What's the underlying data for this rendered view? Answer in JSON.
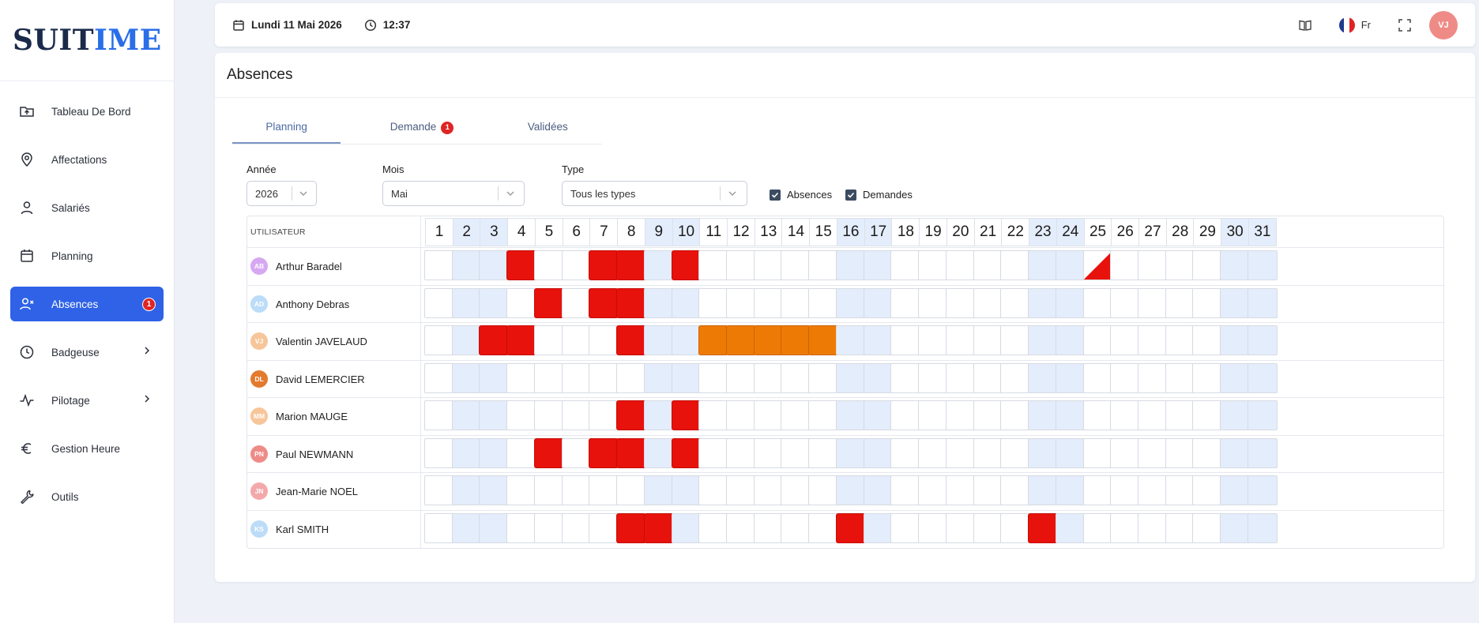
{
  "app": {
    "logo": "SUITIME",
    "logo_accent_start": 4
  },
  "colors": {
    "primary": "#2f62e6",
    "absence": "#e8120c",
    "request": "#ee7a06",
    "weekend": "#e4edfb",
    "badge": "#e02424"
  },
  "sidebar": {
    "items": [
      {
        "label": "Tableau De Bord",
        "icon": "folder-upload-icon",
        "active": false
      },
      {
        "label": "Affectations",
        "icon": "map-pin-icon",
        "active": false
      },
      {
        "label": "Salariés",
        "icon": "user-icon",
        "active": false
      },
      {
        "label": "Planning",
        "icon": "calendar-icon",
        "active": false
      },
      {
        "label": "Absences",
        "icon": "user-x-icon",
        "active": true,
        "badge": "1"
      },
      {
        "label": "Badgeuse",
        "icon": "clock-icon",
        "active": false,
        "chevron": true
      },
      {
        "label": "Pilotage",
        "icon": "activity-icon",
        "active": false,
        "chevron": true
      },
      {
        "label": "Gestion Heure",
        "icon": "euro-icon",
        "active": false
      },
      {
        "label": "Outils",
        "icon": "wrench-icon",
        "active": false
      }
    ]
  },
  "topbar": {
    "date": "Lundi 11 Mai 2026",
    "time": "12:37",
    "language": "Fr",
    "user_initials": "VJ"
  },
  "page": {
    "title": "Absences",
    "tabs": [
      {
        "label": "Planning",
        "active": true
      },
      {
        "label": "Demande",
        "badge": "1"
      },
      {
        "label": "Validées"
      }
    ],
    "filters": {
      "year_label": "Année",
      "year_value": "2026",
      "month_label": "Mois",
      "month_value": "Mai",
      "type_label": "Type",
      "type_value": "Tous les types",
      "absences_label": "Absences",
      "absences_checked": true,
      "demandes_label": "Demandes",
      "demandes_checked": true
    }
  },
  "planning": {
    "user_header": "UTILISATEUR",
    "days": [
      "1",
      "2",
      "3",
      "4",
      "5",
      "6",
      "7",
      "8",
      "9",
      "10",
      "11",
      "12",
      "13",
      "14",
      "15",
      "16",
      "17",
      "18",
      "19",
      "20",
      "21",
      "22",
      "23",
      "24",
      "25",
      "26",
      "27",
      "28",
      "29",
      "30",
      "31"
    ],
    "weekend_days": [
      2,
      3,
      9,
      10,
      16,
      17,
      23,
      24,
      30,
      31
    ],
    "users": [
      {
        "initials": "AB",
        "name": "Arthur Baradel",
        "avatar_color": "#d7a8f2",
        "absences": [
          4,
          7,
          8,
          10
        ],
        "requests": [],
        "half": [
          25
        ]
      },
      {
        "initials": "AD",
        "name": "Anthony Debras",
        "avatar_color": "#bcdcf7",
        "absences": [
          5,
          7,
          8
        ],
        "requests": [],
        "half": []
      },
      {
        "initials": "VJ",
        "name": "Valentin JAVELAUD",
        "avatar_color": "#f6c69a",
        "absences": [
          3,
          4,
          8
        ],
        "requests": [
          11,
          12,
          13,
          14,
          15
        ],
        "half": []
      },
      {
        "initials": "DL",
        "name": "David LEMERCIER",
        "avatar_color": "#e27b2e",
        "absences": [],
        "requests": [],
        "half": []
      },
      {
        "initials": "MM",
        "name": "Marion MAUGE",
        "avatar_color": "#f6c69a",
        "absences": [
          8,
          10
        ],
        "requests": [],
        "half": []
      },
      {
        "initials": "PN",
        "name": "Paul NEWMANN",
        "avatar_color": "#ef8b87",
        "absences": [
          5,
          7,
          8,
          10
        ],
        "requests": [],
        "half": []
      },
      {
        "initials": "JN",
        "name": "Jean-Marie NOEL",
        "avatar_color": "#f3a9ab",
        "absences": [],
        "requests": [],
        "half": []
      },
      {
        "initials": "KS",
        "name": "Karl SMITH",
        "avatar_color": "#bcdcf7",
        "absences": [
          8,
          9,
          16,
          23
        ],
        "requests": [],
        "half": []
      }
    ]
  }
}
